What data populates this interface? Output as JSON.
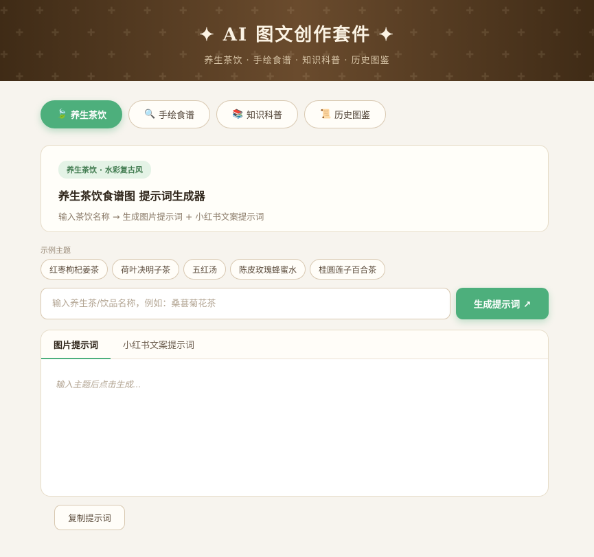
{
  "header": {
    "title": "✦ AI 图文创作套件 ✦",
    "subtitle": "养生茶饮 · 手绘食谱 · 知识科普 · 历史图鉴"
  },
  "tabs": [
    {
      "label": "养生茶饮",
      "icon": "leaf-icon",
      "glyph": "🍃",
      "active": true
    },
    {
      "label": "手绘食谱",
      "icon": "magnifier-icon",
      "glyph": "🔍",
      "active": false
    },
    {
      "label": "知识科普",
      "icon": "books-icon",
      "glyph": "📚",
      "active": false
    },
    {
      "label": "历史图鉴",
      "icon": "scroll-icon",
      "glyph": "📜",
      "active": false
    }
  ],
  "intro": {
    "badge": "养生茶饮 · 水彩复古风",
    "title": "养生茶饮食谱图 提示词生成器",
    "description": "输入茶饮名称 → 生成图片提示词 + 小红书文案提示词"
  },
  "examples": {
    "label": "示例主题",
    "items": [
      "红枣枸杞姜茶",
      "荷叶决明子茶",
      "五红汤",
      "陈皮玫瑰蜂蜜水",
      "桂圆莲子百合茶"
    ]
  },
  "input": {
    "placeholder": "输入养生茶/饮品名称，例如：桑葚菊花茶",
    "value": ""
  },
  "generate_button": "生成提示词 ↗",
  "output": {
    "tabs": [
      {
        "label": "图片提示词",
        "active": true
      },
      {
        "label": "小红书文案提示词",
        "active": false
      }
    ],
    "placeholder": "输入主题后点击生成..."
  },
  "copy_button": "复制提示词",
  "colors": {
    "accent": "#4daf7c",
    "header_dark": "#3f2b16",
    "background": "#f7f4ee"
  }
}
